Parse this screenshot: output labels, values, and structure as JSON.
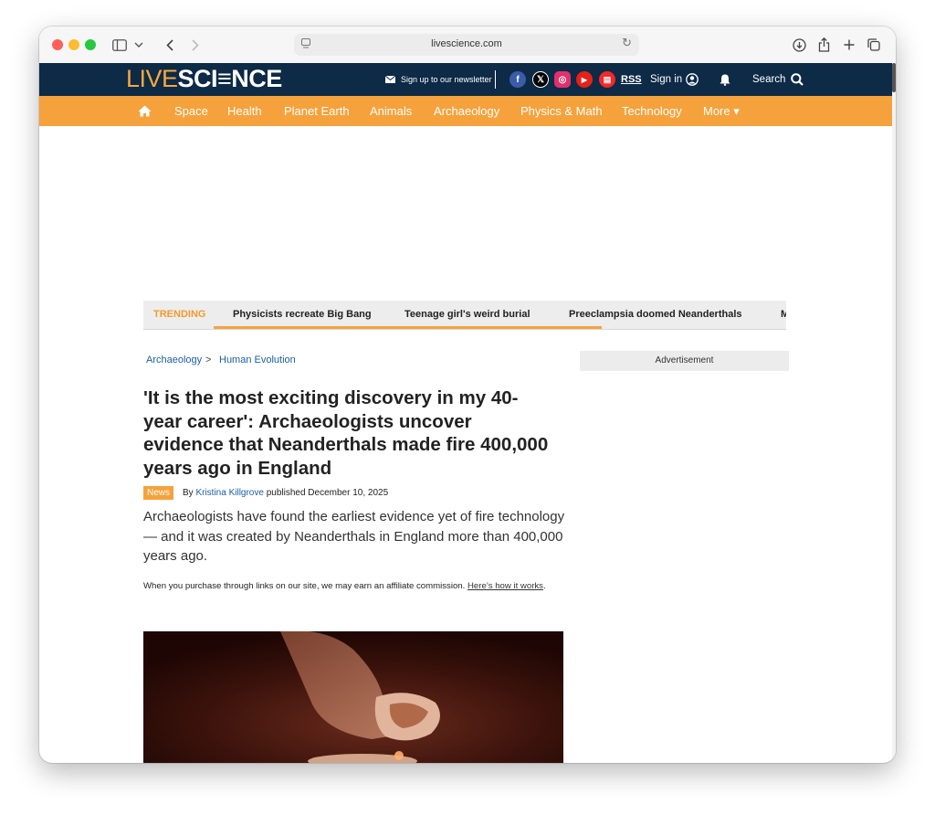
{
  "browser": {
    "url": "livescience.com"
  },
  "site": {
    "logo_live": "LIVE",
    "logo_science": "SCI≡NCE",
    "newsletter": "Sign up to our newsletter",
    "social": [
      "f",
      "𝕏",
      "◎",
      "▶",
      "▤"
    ],
    "rss": "RSS",
    "sign_in": "Sign in",
    "search": "Search",
    "colors": {
      "header": "#0d2a47",
      "nav": "#f6a23c",
      "accent": "#f39a2b"
    }
  },
  "nav": {
    "items": [
      "Space",
      "Health",
      "Planet Earth",
      "Animals",
      "Archaeology",
      "Physics & Math",
      "Technology",
      "More ▾"
    ]
  },
  "trending": {
    "label": "TRENDING",
    "items": [
      "Physicists recreate Big Bang",
      "Teenage girl's weird burial",
      "Preeclampsia doomed Neanderthals",
      "M"
    ]
  },
  "breadcrumb": {
    "items": [
      "Archaeology",
      "Human Evolution"
    ],
    "separator": ">"
  },
  "article": {
    "headline": "'It is the most exciting discovery in my 40-year career': Archaeologists uncover evidence that Neanderthals made fire 400,000 years ago in England",
    "badge": "News",
    "by": "By",
    "author": "Kristina Killgrove",
    "published": "published December 10, 2025",
    "standfirst": "Archaeologists have found the earliest evidence yet of fire technology — and it was created by Neanderthals in England more than 400,000 years ago.",
    "disclaimer": "When you purchase through links on our site, we may earn an affiliate commission.",
    "disclaimer_link": "Here’s how it works",
    "disclaimer_end": "."
  },
  "sidebar": {
    "ad_label": "Advertisement"
  }
}
